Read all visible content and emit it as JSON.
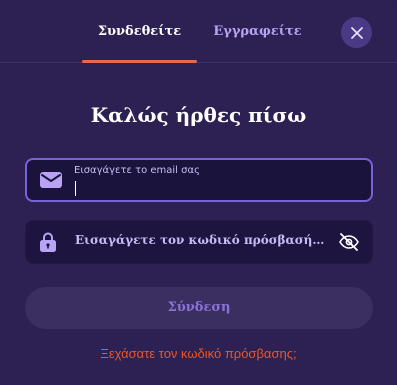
{
  "tabs": {
    "login_label": "Συνδεθείτε",
    "register_label": "Εγγραφείτε"
  },
  "form": {
    "title": "Καλώς ήρθες πίσω",
    "email_label": "Εισαγάγετε το email σας",
    "email_value": "",
    "password_placeholder": "Εισαγάγετε τον κωδικό πρόσβασής σας",
    "submit_label": "Σύνδεση",
    "forgot_label": "Ξεχάσατε τον κωδικό πρόσβασης;"
  },
  "icons": {
    "close": "close-icon",
    "email": "envelope-icon",
    "password": "lock-icon",
    "visibility": "eye-off-icon"
  },
  "colors": {
    "background": "#2c2152",
    "accent": "#e8674a",
    "icon": "#b9a3f5",
    "link": "#e5582e",
    "button_text": "#8a72d8"
  }
}
